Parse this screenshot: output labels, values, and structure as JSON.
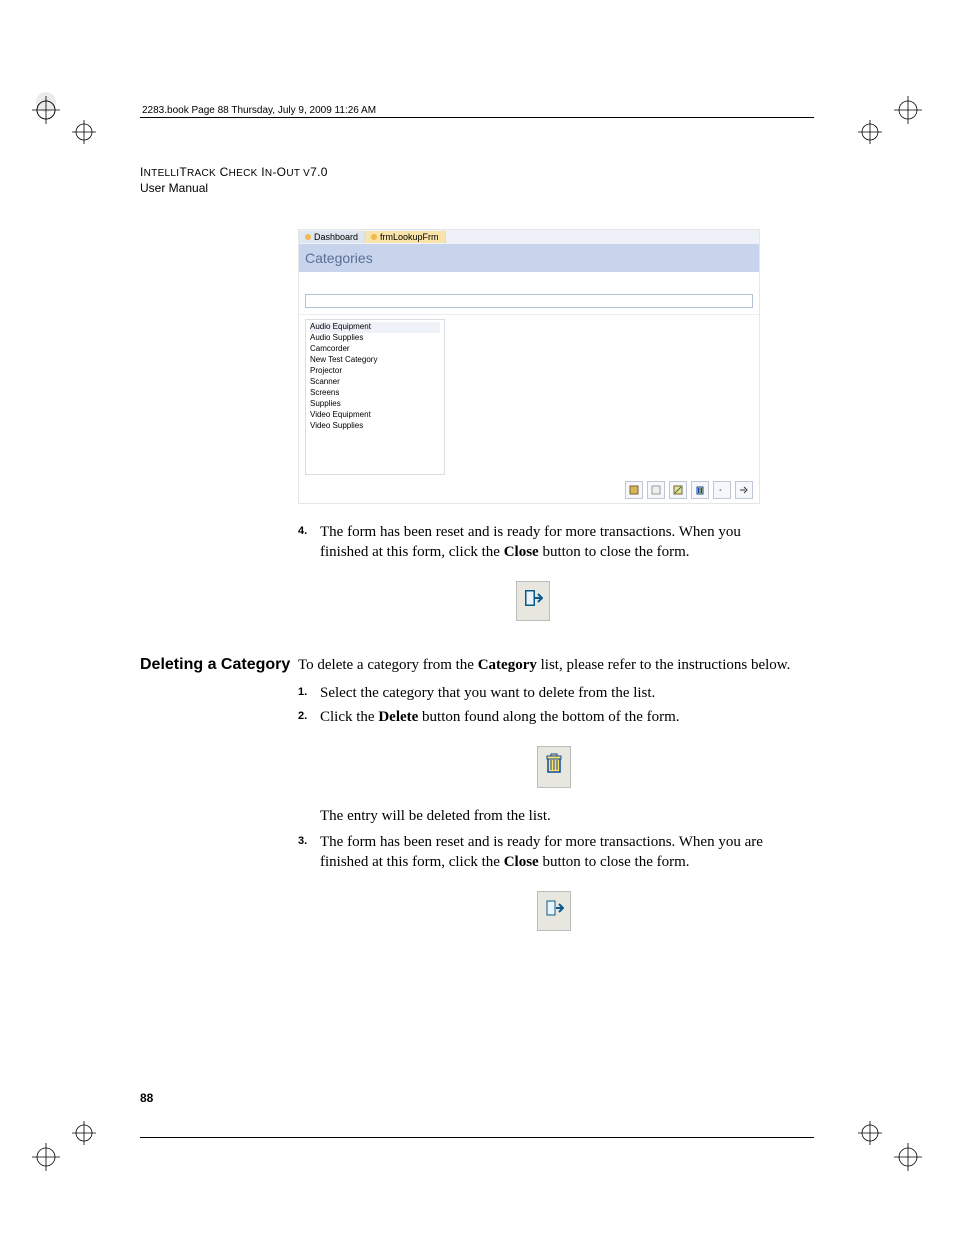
{
  "header_tag": "2283.book  Page 88  Thursday, July 9, 2009  11:26 AM",
  "doc_title_sc": "IntelliTrack Check In-Out v7.0",
  "doc_subtitle": "User Manual",
  "screenshot": {
    "tab1": "Dashboard",
    "tab2": "frmLookupFrm",
    "title": "Categories",
    "items": [
      "Audio Equipment",
      "Audio Supplies",
      "Camcorder",
      "New Test Category",
      "Projector",
      "Scanner",
      "Screens",
      "Supplies",
      "Video Equipment",
      "Video Supplies"
    ]
  },
  "step4_num": "4.",
  "step4_a": "The form has been reset and is ready for more transactions. When you finished at this form, click the ",
  "step4_bold": "Close",
  "step4_b": " button to close the form.",
  "section_title": "Deleting a Category",
  "section_intro_a": "To delete a category from the ",
  "section_intro_bold": "Category",
  "section_intro_b": " list, please refer to the instructions below.",
  "d_step1_num": "1.",
  "d_step1_txt": "Select the category that you want to delete from the list.",
  "d_step2_num": "2.",
  "d_step2_a": "Click the ",
  "d_step2_bold": "Delete",
  "d_step2_b": " button found along the bottom of the form.",
  "d_note": "The entry will be deleted from the list.",
  "d_step3_num": "3.",
  "d_step3_a": "The form has been reset and is ready for more transactions. When you are finished at this form, click the ",
  "d_step3_bold": "Close",
  "d_step3_b": " button to close the form.",
  "page_number": "88"
}
